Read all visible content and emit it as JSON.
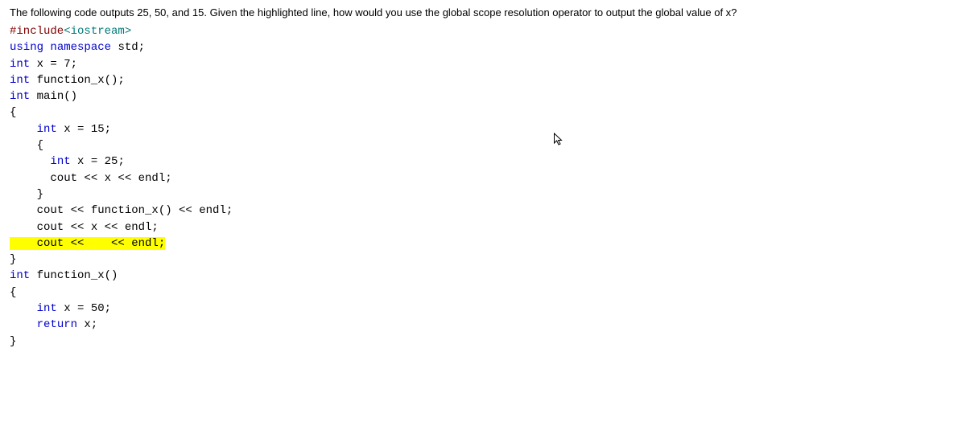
{
  "question": "The following code outputs 25, 50, and 15.  Given the highlighted line, how would you use the global scope resolution operator to output the global value of x?",
  "code": {
    "l1a": "#include",
    "l1b": "<iostream>",
    "l2a": "using",
    "l2b": " ",
    "l2c": "namespace",
    "l2d": " std;",
    "l3a": "int",
    "l3b": " x = 7;",
    "l4a": "int",
    "l4b": " function_x();",
    "l5a": "int",
    "l5b": " main()",
    "l6": "{",
    "l7a": "    ",
    "l7b": "int",
    "l7c": " x = 15;",
    "l8": "    {",
    "l9a": "      ",
    "l9b": "int",
    "l9c": " x = 25;",
    "l10": "      cout << x << endl;",
    "l11": "    }",
    "l12": "    cout << function_x() << endl;",
    "l13": "    cout << x << endl;",
    "l14": "    cout <<    << endl;",
    "l15": "}",
    "l16a": "int",
    "l16b": " function_x()",
    "l17": "{",
    "l18a": "    ",
    "l18b": "int",
    "l18c": " x = 50;",
    "l19a": "    ",
    "l19b": "return",
    "l19c": " x;",
    "l20": "}"
  }
}
